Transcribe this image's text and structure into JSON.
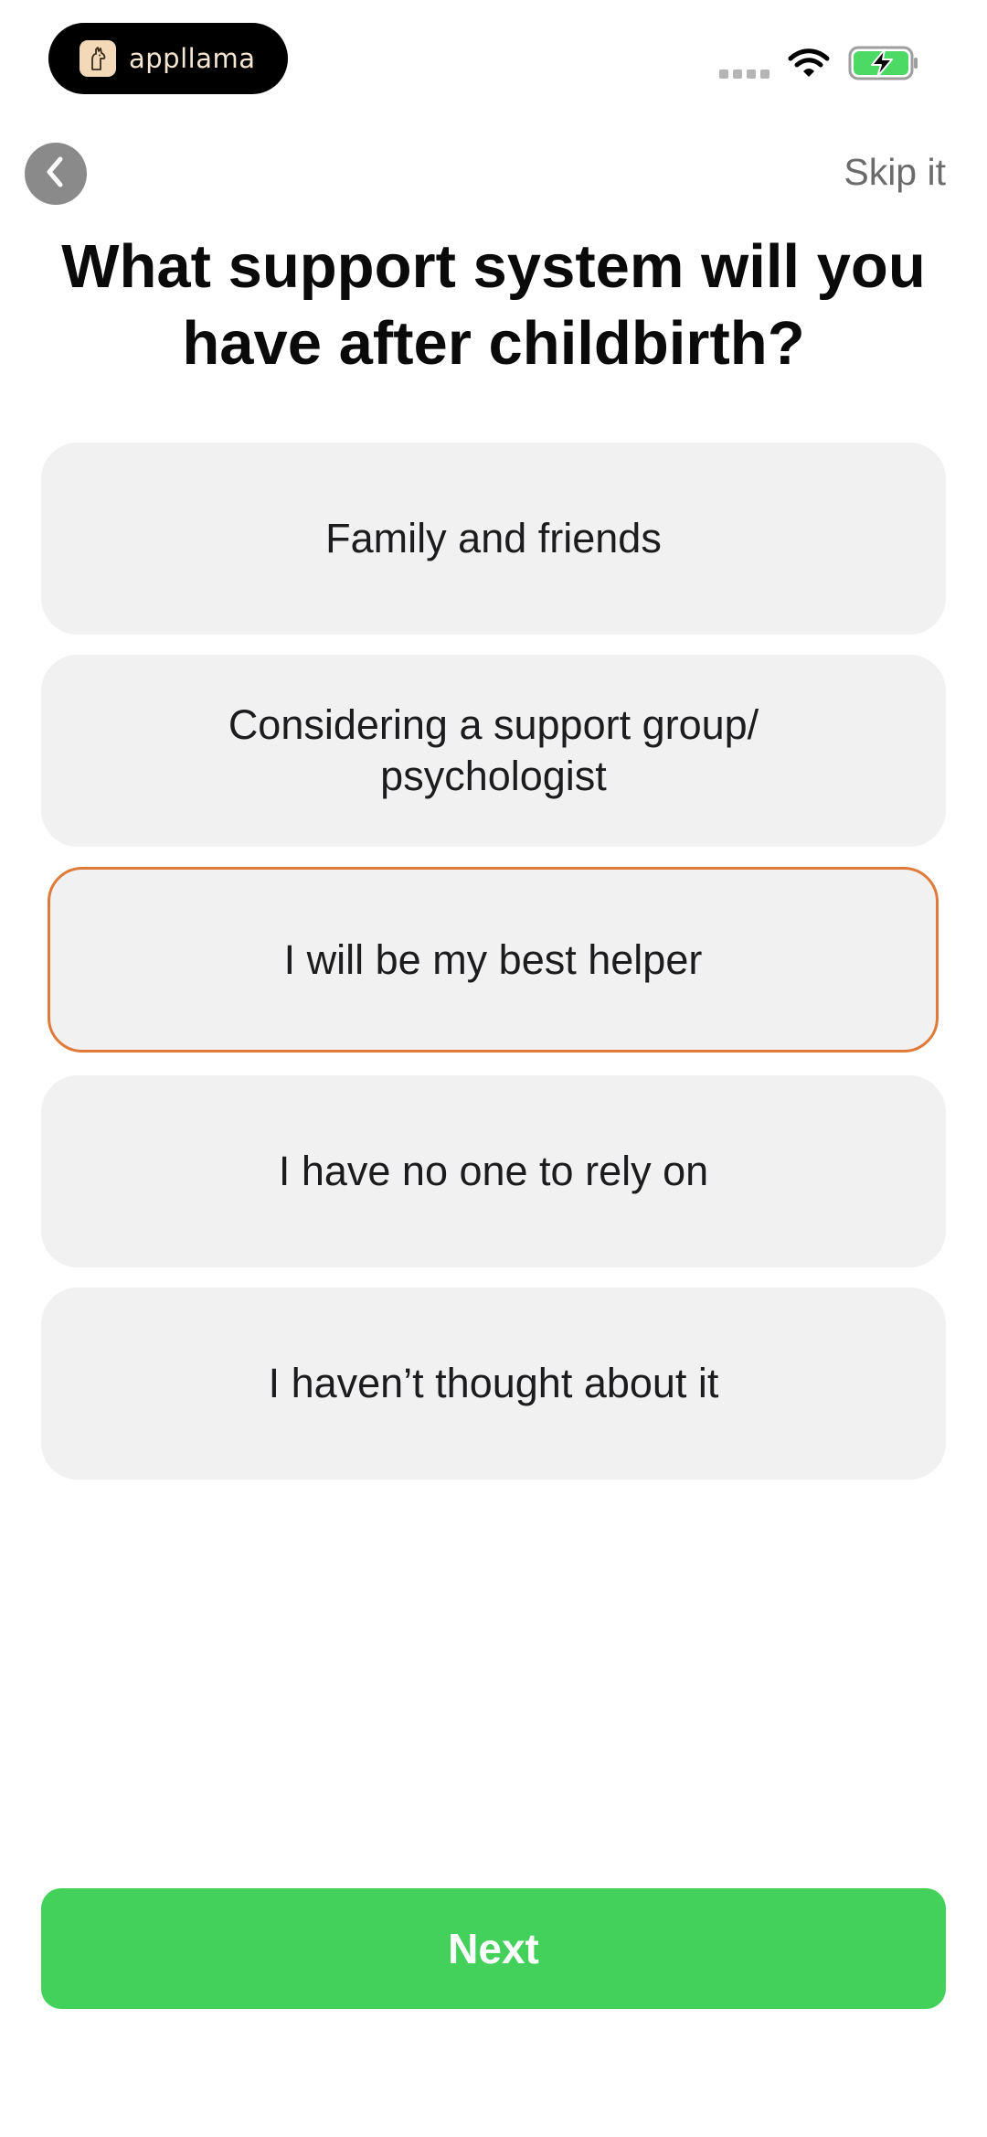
{
  "status_bar": {
    "brand_name": "appllama",
    "icons": [
      "signal-dots-icon",
      "wifi-icon",
      "battery-charging-icon"
    ]
  },
  "header": {
    "back_icon": "chevron-left-icon",
    "skip_label": "Skip it"
  },
  "question": {
    "title": "What support system will you have after childbirth?"
  },
  "options": [
    {
      "label": "Family and friends",
      "selected": false
    },
    {
      "label": "Considering a support group/ psychologist",
      "selected": false
    },
    {
      "label": "I will be my best helper",
      "selected": true
    },
    {
      "label": "I have no one to rely on",
      "selected": false
    },
    {
      "label": "I haven’t thought about it",
      "selected": false
    }
  ],
  "footer": {
    "next_label": "Next"
  },
  "colors": {
    "accent_selected": "#e07a3a",
    "primary_button": "#44d15b",
    "option_background": "#f1f1f1",
    "battery_green": "#4cd964"
  }
}
